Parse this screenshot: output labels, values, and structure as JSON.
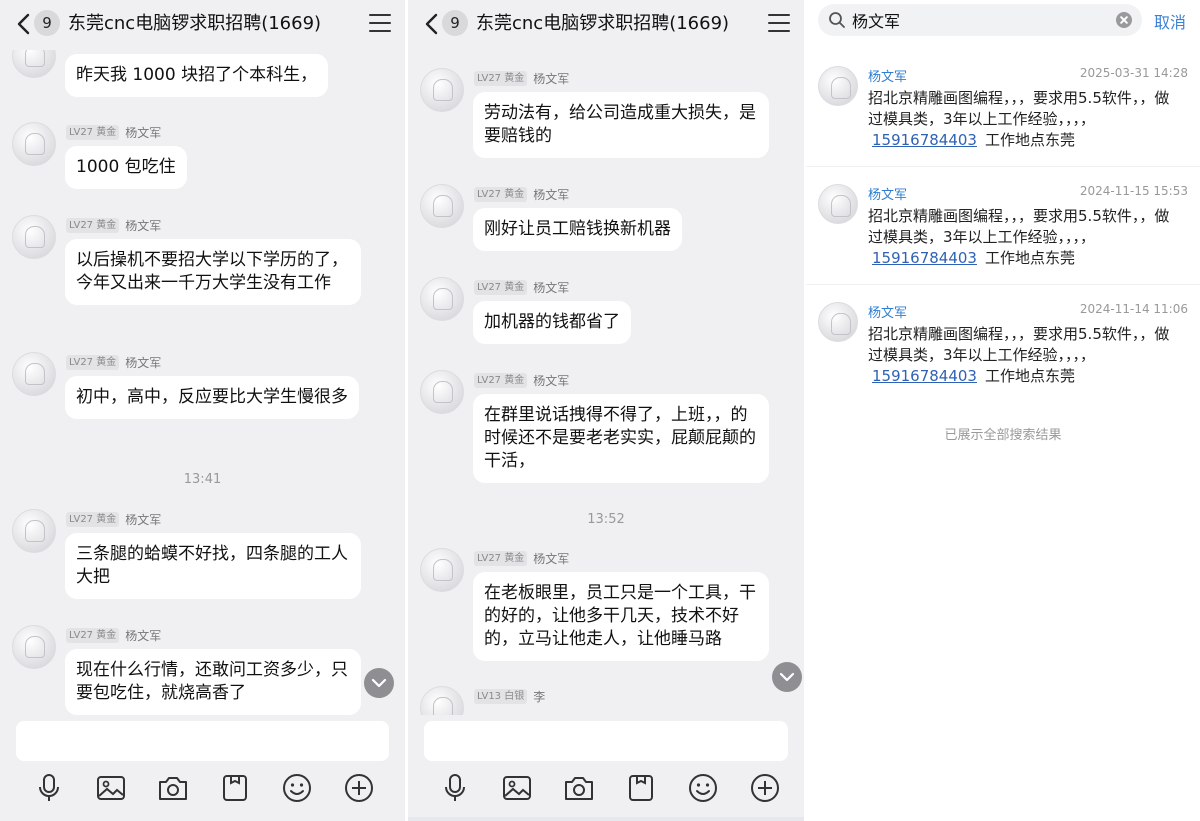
{
  "left_chat": {
    "badge": "9",
    "title": "东莞cnc电脑锣求职招聘(1669)",
    "messages": [
      {
        "level": "",
        "sender": "",
        "text": "昨天我 1000 块招了个本科生，"
      },
      {
        "level": "LV27 黄金",
        "sender": "杨文军",
        "text": "1000 包吃住"
      },
      {
        "level": "LV27 黄金",
        "sender": "杨文军",
        "text": "以后操机不要招大学以下学历的了，今年又出来一千万大学生没有工作"
      },
      {
        "level": "LV27 黄金",
        "sender": "杨文军",
        "text": "初中，高中，反应要比大学生慢很多"
      },
      {
        "level": "LV27 黄金",
        "sender": "杨文军",
        "text": "三条腿的蛤蟆不好找，四条腿的工人大把"
      },
      {
        "level": "LV27 黄金",
        "sender": "杨文军",
        "text": "现在什么行情，还敢问工资多少，只要包吃住，就烧高香了"
      }
    ],
    "time_divider": "13:41"
  },
  "right_chat": {
    "badge": "9",
    "title": "东莞cnc电脑锣求职招聘(1669)",
    "messages": [
      {
        "level": "LV27 黄金",
        "sender": "杨文军",
        "text": "劳动法有，给公司造成重大损失，是要赔钱的"
      },
      {
        "level": "LV27 黄金",
        "sender": "杨文军",
        "text": "刚好让员工赔钱换新机器"
      },
      {
        "level": "LV27 黄金",
        "sender": "杨文军",
        "text": "加机器的钱都省了"
      },
      {
        "level": "LV27 黄金",
        "sender": "杨文军",
        "text": "在群里说话拽得不得了，上班，，的时候还不是要老老实实，屁颠屁颠的干活，"
      },
      {
        "level": "LV27 黄金",
        "sender": "杨文军",
        "text": "在老板眼里，员工只是一个工具，干的好的，让他多干几天，技术不好的，立马让他走人，让他睡马路"
      },
      {
        "level": "LV13 白银",
        "sender": "李",
        "text": ""
      }
    ],
    "time_divider": "13:52"
  },
  "search": {
    "query": "杨文军",
    "cancel_label": "取消",
    "results": [
      {
        "name": "杨文军",
        "time": "2025-03-31 14:28",
        "text_before": "招北京精雕画图编程，，，要求用5.5软件，，做过模具类，3年以上工作经验，，，，",
        "phone": "15916784403",
        "text_after": "工作地点东莞"
      },
      {
        "name": "杨文军",
        "time": "2024-11-15 15:53",
        "text_before": "招北京精雕画图编程，，，要求用5.5软件，，做过模具类，3年以上工作经验，，，，",
        "phone": "15916784403",
        "text_after": "工作地点东莞"
      },
      {
        "name": "杨文军",
        "time": "2024-11-14 11:06",
        "text_before": "招北京精雕画图编程，，，要求用5.5软件，，做过模具类，3年以上工作经验，，，，",
        "phone": "15916784403",
        "text_after": "工作地点东莞"
      }
    ],
    "all_shown": "已展示全部搜索结果"
  },
  "icons": [
    "back-icon",
    "menu-icon",
    "mic-icon",
    "image-icon",
    "camera-icon",
    "file-icon",
    "emoji-icon",
    "plus-icon",
    "search-icon",
    "clear-icon",
    "scroll-down-icon"
  ]
}
